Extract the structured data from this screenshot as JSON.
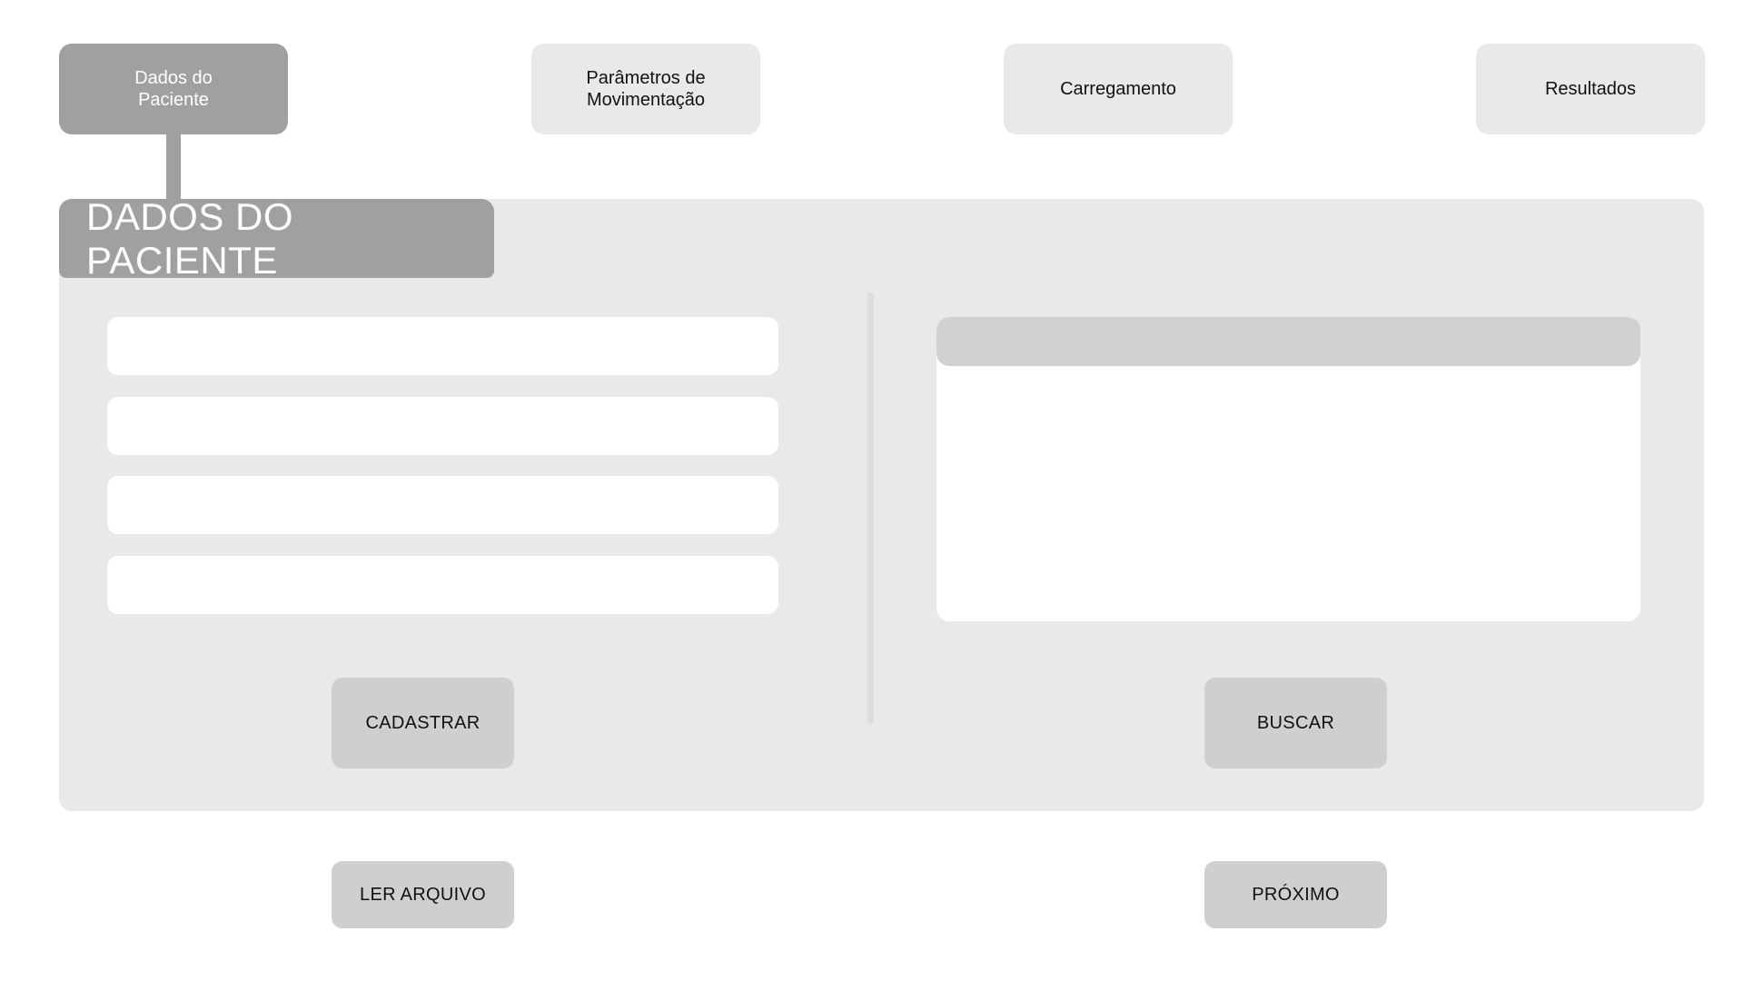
{
  "steps": [
    {
      "label": "Dados do\nPaciente",
      "active": true
    },
    {
      "label": "Parâmetros de\nMovimentação",
      "active": false
    },
    {
      "label": "Carregamento",
      "active": false
    },
    {
      "label": "Resultados",
      "active": false
    }
  ],
  "panel": {
    "title": "DADOS DO PACIENTE"
  },
  "form": {
    "fields": [
      {
        "value": "",
        "placeholder": ""
      },
      {
        "value": "",
        "placeholder": ""
      },
      {
        "value": "",
        "placeholder": ""
      },
      {
        "value": "",
        "placeholder": ""
      }
    ],
    "cadastrar_label": "CADASTRAR"
  },
  "search": {
    "buscar_label": "BUSCAR"
  },
  "footer": {
    "ler_arquivo_label": "LER ARQUIVO",
    "proximo_label": "PRÓXIMO"
  },
  "colors": {
    "active_tab": "#a0a0a0",
    "inactive_tab": "#e9e9e9",
    "panel_bg": "#e9e9e9",
    "button_bg": "#cfcfcf",
    "results_header": "#d0d0d0"
  }
}
